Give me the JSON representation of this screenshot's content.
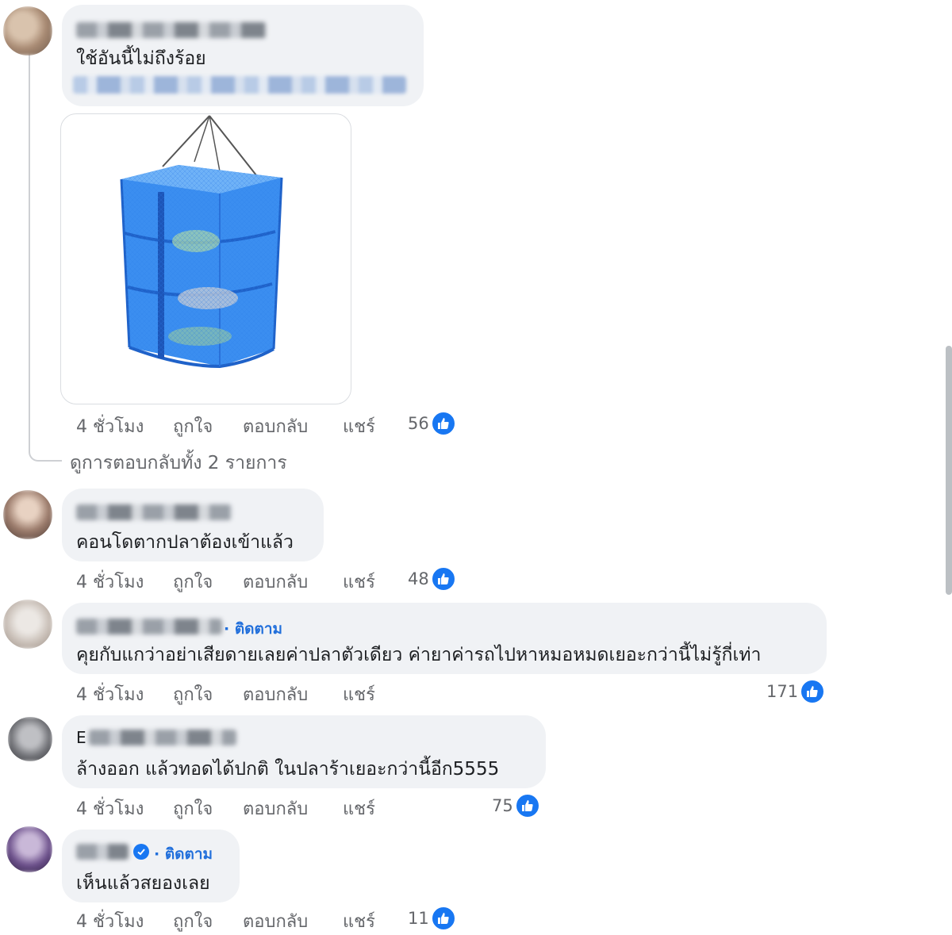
{
  "comments": [
    {
      "text": "ใช้อันนี้ไม่ถึงร้อย",
      "time": "4 ชั่วโมง",
      "like": "ถูกใจ",
      "reply": "ตอบกลับ",
      "share": "แชร์",
      "reactions": "56"
    },
    {
      "text": "คอนโดตากปลาต้องเข้าแล้ว",
      "time": "4 ชั่วโมง",
      "like": "ถูกใจ",
      "reply": "ตอบกลับ",
      "share": "แชร์",
      "reactions": "48"
    },
    {
      "follow": "· ติดตาม",
      "text": "คุยกับแกว่าอย่าเสียดายเลยค่าปลาตัวเดียว ค่ายาค่ารถไปหาหมอหมดเยอะกว่านี้ไม่รู้กี่เท่า",
      "time": "4 ชั่วโมง",
      "like": "ถูกใจ",
      "reply": "ตอบกลับ",
      "share": "แชร์",
      "reactions": "171"
    },
    {
      "name_initial": "E",
      "text": "ล้างออก แล้วทอดได้ปกติ ในปลาร้าเยอะกว่านี้อีก5555",
      "time": "4 ชั่วโมง",
      "like": "ถูกใจ",
      "reply": "ตอบกลับ",
      "share": "แชร์",
      "reactions": "75"
    },
    {
      "follow": "· ติดตาม",
      "text": "เห็นแล้วสยองเลย",
      "time": "4 ชั่วโมง",
      "like": "ถูกใจ",
      "reply": "ตอบกลับ",
      "share": "แชร์",
      "reactions": "11"
    }
  ],
  "view_replies": "ดูการตอบกลับทั้ง 2 รายการ",
  "colors": {
    "bubble": "#f0f2f5",
    "link_blue": "#216fdb",
    "like_blue": "#1877f2",
    "meta_gray": "#65676b"
  },
  "icons": [
    "like-thumb-icon",
    "verified-badge-icon"
  ]
}
